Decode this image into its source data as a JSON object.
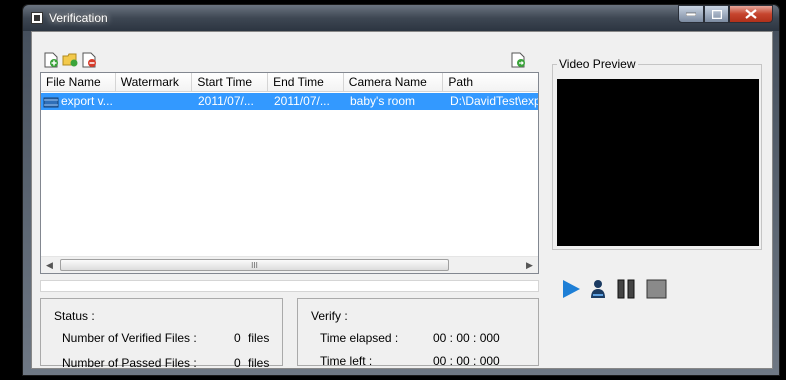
{
  "window": {
    "title": "Verification"
  },
  "toolbar": {
    "icons": [
      "add-file-icon",
      "open-folder-icon",
      "remove-file-icon",
      "export-file-icon"
    ]
  },
  "table": {
    "columns": [
      "File Name",
      "Watermark",
      "Start Time",
      "End Time",
      "Camera Name",
      "Path"
    ],
    "rows": [
      [
        "export v...",
        "",
        "2011/07/...",
        "2011/07/...",
        "baby's room",
        "D:\\DavidTest\\exp"
      ]
    ],
    "scrollbar_grip": "III"
  },
  "status": {
    "heading": "Status :",
    "verified_label": "Number of Verified Files :",
    "verified_value": "0",
    "verified_unit": "files",
    "passed_label": "Number of Passed Files :",
    "passed_value": "0",
    "passed_unit": "files"
  },
  "verify": {
    "heading": "Verify :",
    "elapsed_label": "Time elapsed :",
    "elapsed_value": "00 : 00 : 000",
    "left_label": "Time left :",
    "left_value": "00 : 00 : 000"
  },
  "preview": {
    "legend": "Video Preview"
  },
  "player": {
    "icons": [
      "play-icon",
      "user-icon",
      "pause-icon",
      "stop-icon"
    ],
    "accent": "#1e7fd6"
  },
  "colors": {
    "selection": "#3399ff",
    "client_bg": "#f0f0f0"
  }
}
